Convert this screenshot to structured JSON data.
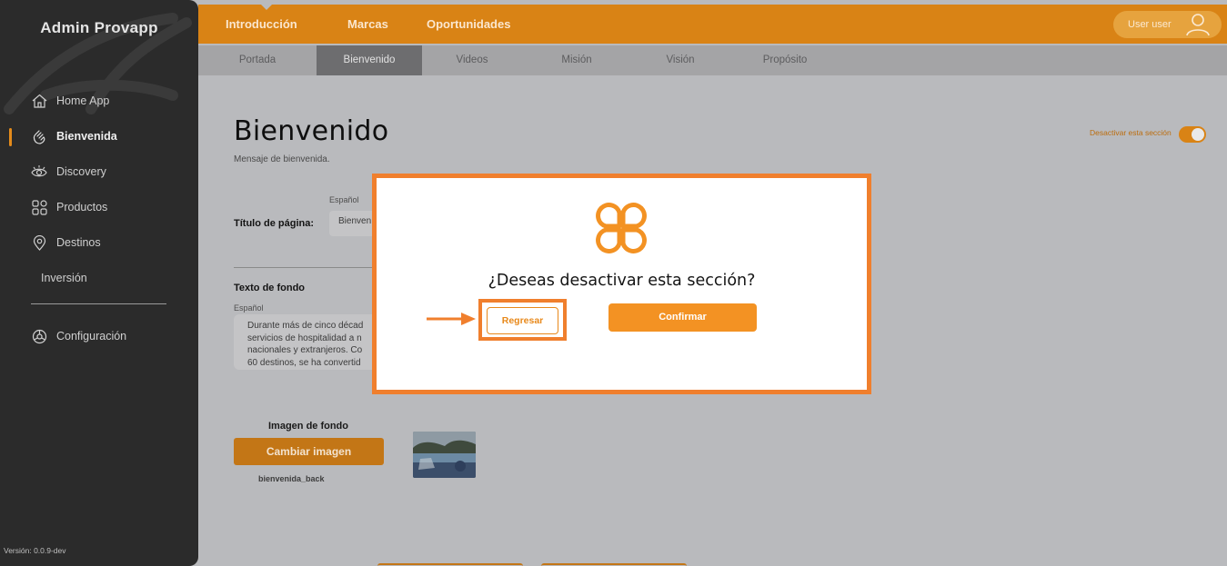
{
  "app": {
    "title": "Admin Provapp",
    "version": "Versión: 0.0.9-dev"
  },
  "sidebar": {
    "items": [
      {
        "label": "Home App",
        "icon": "home-icon"
      },
      {
        "label": "Bienvenida",
        "icon": "waving-hand-icon",
        "active": true
      },
      {
        "label": "Discovery",
        "icon": "eye-icon"
      },
      {
        "label": "Productos",
        "icon": "grid-icon"
      },
      {
        "label": "Destinos",
        "icon": "location-pin-icon"
      },
      {
        "label": "Inversión",
        "icon": ""
      },
      {
        "label": "Configuración",
        "icon": "settings-icon"
      }
    ]
  },
  "topbar": {
    "tabs": [
      "Introducción",
      "Marcas",
      "Oportunidades"
    ],
    "user": "User user"
  },
  "subtabs": [
    "Portada",
    "Bienvenido",
    "Videos",
    "Misión",
    "Visión",
    "Propósito"
  ],
  "page": {
    "title": "Bienvenido",
    "subtitle": "Mensaje de bienvenida.",
    "toggle_label": "Desactivar esta sección",
    "toggle_on": true,
    "title_field": {
      "label": "Título de página:",
      "lang": "Español",
      "value": "Bienven"
    },
    "background_text": {
      "label": "Texto de fondo",
      "lang": "Español",
      "value": "Durante más de cinco décad\nservicios de hospitalidad a n\nnacionales y extranjeros. Co\n60 destinos, se ha convertid"
    },
    "image": {
      "label": "Imagen de fondo",
      "button": "Cambiar imagen",
      "filename": "bienvenida_back"
    }
  },
  "modal": {
    "question": "¿Deseas desactivar esta sección?",
    "back_label": "Regresar",
    "confirm_label": "Confirmar"
  },
  "colors": {
    "accent": "#d98315",
    "modal_border": "#f07f2d",
    "confirm": "#f39223",
    "sidebar_bg": "#2b2b2b"
  }
}
